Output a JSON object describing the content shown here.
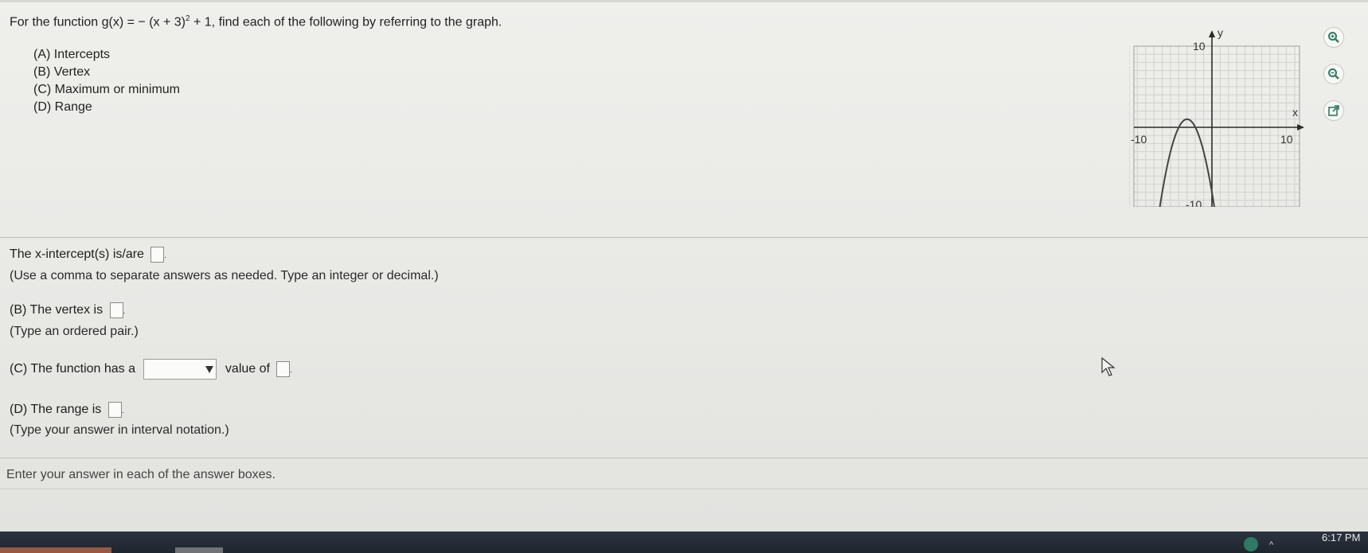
{
  "question": {
    "prefix": "For the function g(x) = − (x + 3)",
    "exponent": "2",
    "suffix": " + 1, find each of the following by referring to the graph."
  },
  "parts": [
    "(A) Intercepts",
    "(B) Vertex",
    "(C) Maximum or minimum",
    "(D) Range"
  ],
  "graph": {
    "x_axis_label": "x",
    "y_axis_label": "y",
    "xmin_label": "-10",
    "xmax_label": "10",
    "ymax_label": "10",
    "ymin_label": "-10",
    "curve": {
      "a": -1,
      "h": -3,
      "k": 1
    },
    "range": [
      -10,
      10
    ],
    "grid": true
  },
  "tools": [
    "zoom-in-icon",
    "zoom-out-icon",
    "popout-icon"
  ],
  "answers": {
    "a_text": "The x-intercept(s) is/are",
    "a_hint": "(Use a comma to separate answers as needed. Type an integer or decimal.)",
    "b_text": "(B) The vertex is",
    "b_hint": "(Type an ordered pair.)",
    "c_text_before": "(C) The function has a",
    "c_text_after": "value of",
    "d_text": "(D) The range is",
    "d_hint": "(Type your answer in interval notation.)",
    "period": "."
  },
  "footer_message": "Enter your answer in each of the answer boxes.",
  "taskbar": {
    "clock": "6:17 PM"
  },
  "colors": {
    "grid": "#cfd3cc",
    "axis": "#2b2b2b",
    "curve": "#444444",
    "accent": "#2f7a66"
  }
}
